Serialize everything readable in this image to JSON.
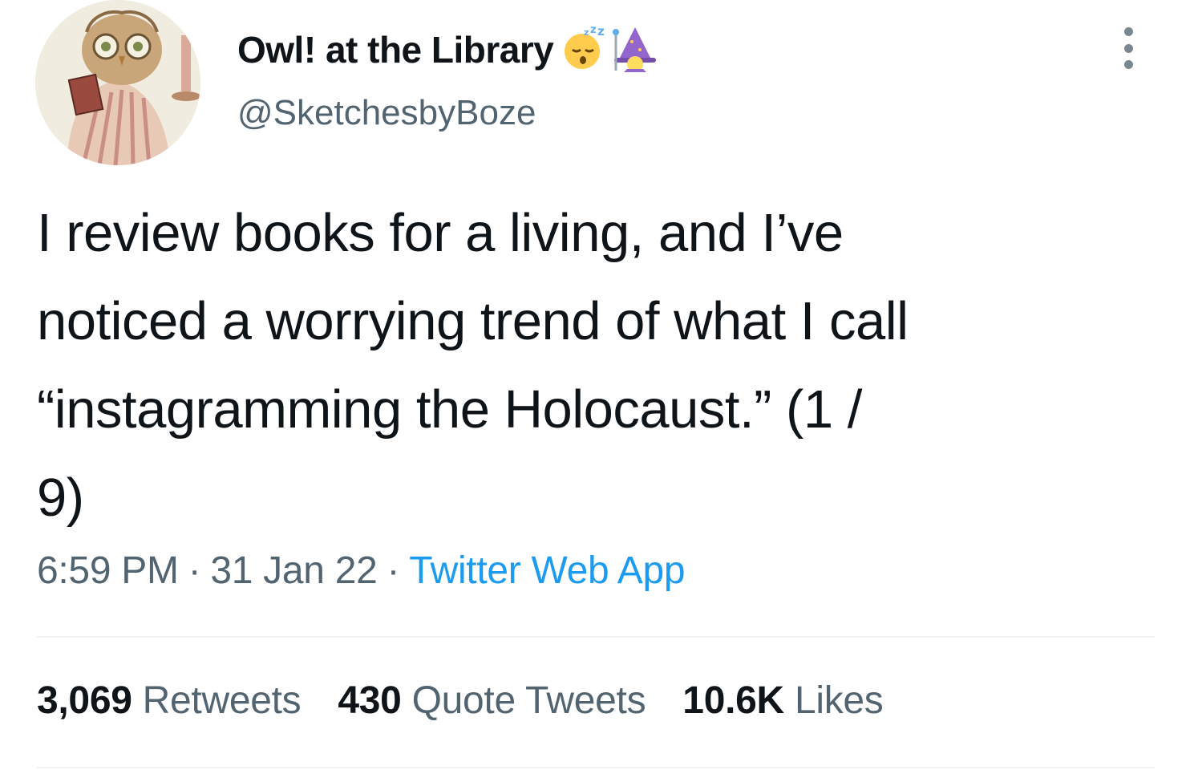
{
  "author": {
    "display_name": "Owl! at the Library",
    "handle": "@SketchesbyBoze",
    "name_emojis": [
      "sleeping-face-emoji",
      "mage-emoji"
    ]
  },
  "tweet": {
    "text": "I review books for a living, and I’ve\nnoticed a worrying trend of what I call\n“instagramming the Holocaust.” (1 /\n9)",
    "time": "6:59 PM",
    "date": "31 Jan 22",
    "source": "Twitter Web App",
    "separator": "·"
  },
  "stats": {
    "retweets_count": "3,069",
    "retweets_label": "Retweets",
    "quotes_count": "430",
    "quotes_label": "Quote Tweets",
    "likes_count": "10.6K",
    "likes_label": "Likes"
  },
  "colors": {
    "text_primary": "#0f1419",
    "text_secondary": "#536471",
    "link": "#1d9bf0",
    "divider": "#eff3f4"
  }
}
